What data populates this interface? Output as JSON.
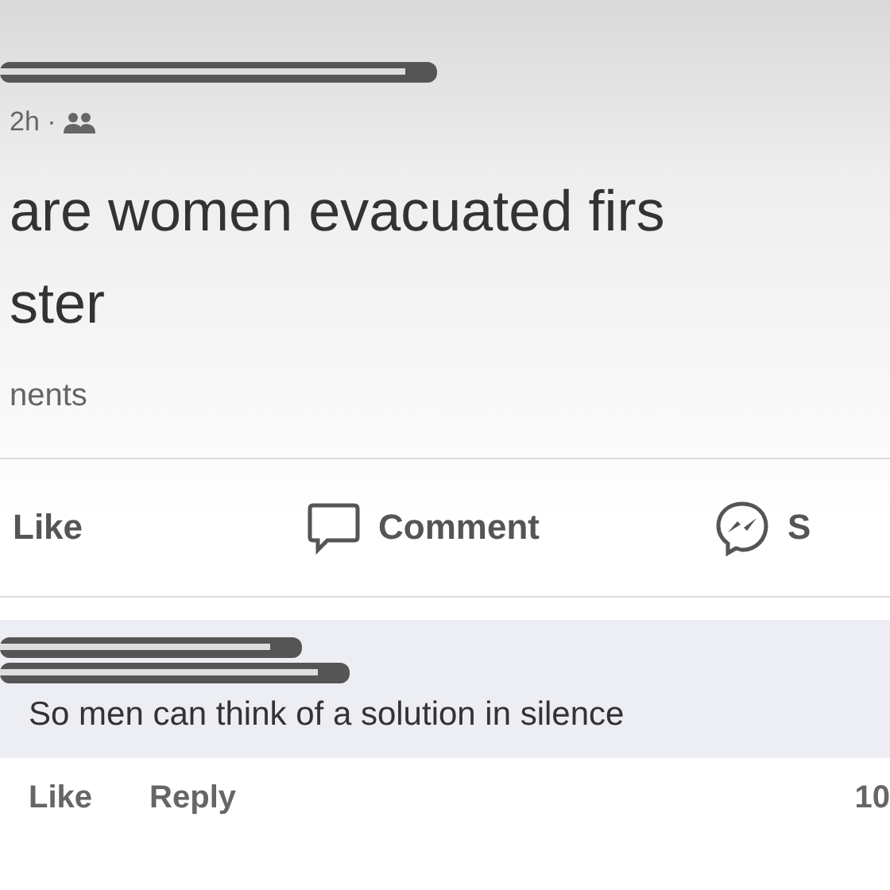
{
  "post": {
    "time": "2h ·",
    "text_lines": [
      "are women evacuated firs",
      "ster"
    ],
    "comments_count": "nents"
  },
  "actions": [
    {
      "kind": "like",
      "label": "Like"
    },
    {
      "kind": "comment",
      "label": "Comment"
    },
    {
      "kind": "share",
      "label": "S"
    }
  ],
  "comment": {
    "text": "So men can think of a solution in silence",
    "actions": [
      "Like",
      "Reply"
    ],
    "time": "10"
  }
}
